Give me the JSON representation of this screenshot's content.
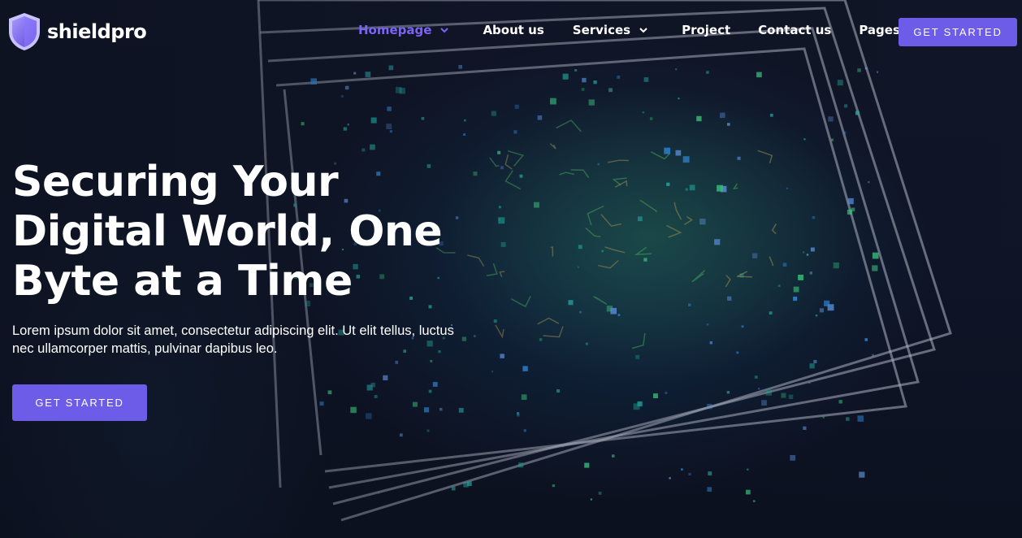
{
  "brand": {
    "name": "shieldpro"
  },
  "nav": {
    "items": [
      {
        "label": "Homepage",
        "dropdown": true,
        "active": true
      },
      {
        "label": "About us",
        "dropdown": false,
        "active": false
      },
      {
        "label": "Services",
        "dropdown": true,
        "active": false
      },
      {
        "label": "Project",
        "dropdown": false,
        "active": false
      },
      {
        "label": "Contact us",
        "dropdown": false,
        "active": false
      },
      {
        "label": "Pages",
        "dropdown": true,
        "active": false
      }
    ],
    "cta_label": "GET STARTED"
  },
  "hero": {
    "title_lines": [
      "Securing Your",
      "Digital World, One",
      "Byte at a Time"
    ],
    "description_lines": [
      "Lorem ipsum dolor sit amet, consectetur adipiscing elit. Ut elit tellus, luctus",
      "nec ullamcorper mattis, pulvinar dapibus leo."
    ],
    "cta_label": "GET STARTED",
    "background_image": "circuit-board-chip"
  },
  "colors": {
    "accent": "#6c5ce7",
    "active_nav": "#7b63f5",
    "background": "#0d1222",
    "text": "#ffffff"
  },
  "icons": {
    "logo": "shield-icon",
    "dropdown": "chevron-down-icon"
  }
}
